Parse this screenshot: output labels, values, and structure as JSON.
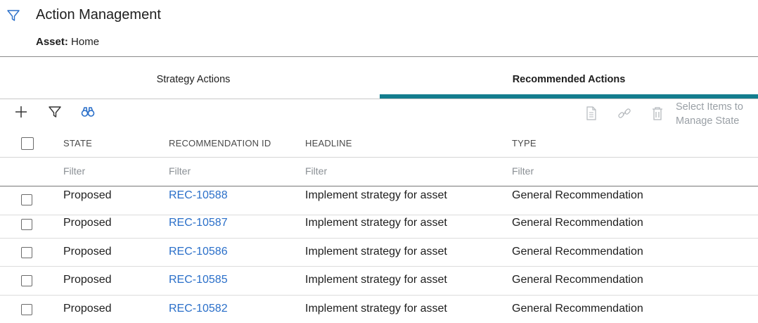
{
  "header": {
    "title": "Action Management",
    "asset_label": "Asset:",
    "asset_value": "Home",
    "filter_icon": "filter-icon"
  },
  "tabs": [
    {
      "label": "Strategy Actions",
      "active": false
    },
    {
      "label": "Recommended Actions",
      "active": true
    }
  ],
  "toolbar": {
    "icons": [
      "plus-icon",
      "filter-icon",
      "binoculars-icon",
      "document-icon",
      "link-icon",
      "trash-icon"
    ],
    "select_note": "Select Items to Manage State"
  },
  "colors": {
    "accent": "#137d8e",
    "link": "#2a6fc9",
    "icon": "#2a6fc9"
  },
  "table": {
    "columns": [
      "STATE",
      "RECOMMENDATION ID",
      "HEADLINE",
      "TYPE"
    ],
    "filter_placeholder": "Filter",
    "rows": [
      {
        "state": "Proposed",
        "id": "REC-10588",
        "headline": "Implement strategy for asset",
        "type": "General Recommendation"
      },
      {
        "state": "Proposed",
        "id": "REC-10587",
        "headline": "Implement strategy for asset",
        "type": "General Recommendation"
      },
      {
        "state": "Proposed",
        "id": "REC-10586",
        "headline": "Implement strategy for asset",
        "type": "General Recommendation"
      },
      {
        "state": "Proposed",
        "id": "REC-10585",
        "headline": "Implement strategy for asset",
        "type": "General Recommendation"
      },
      {
        "state": "Proposed",
        "id": "REC-10582",
        "headline": "Implement strategy for asset",
        "type": "General Recommendation"
      }
    ]
  }
}
